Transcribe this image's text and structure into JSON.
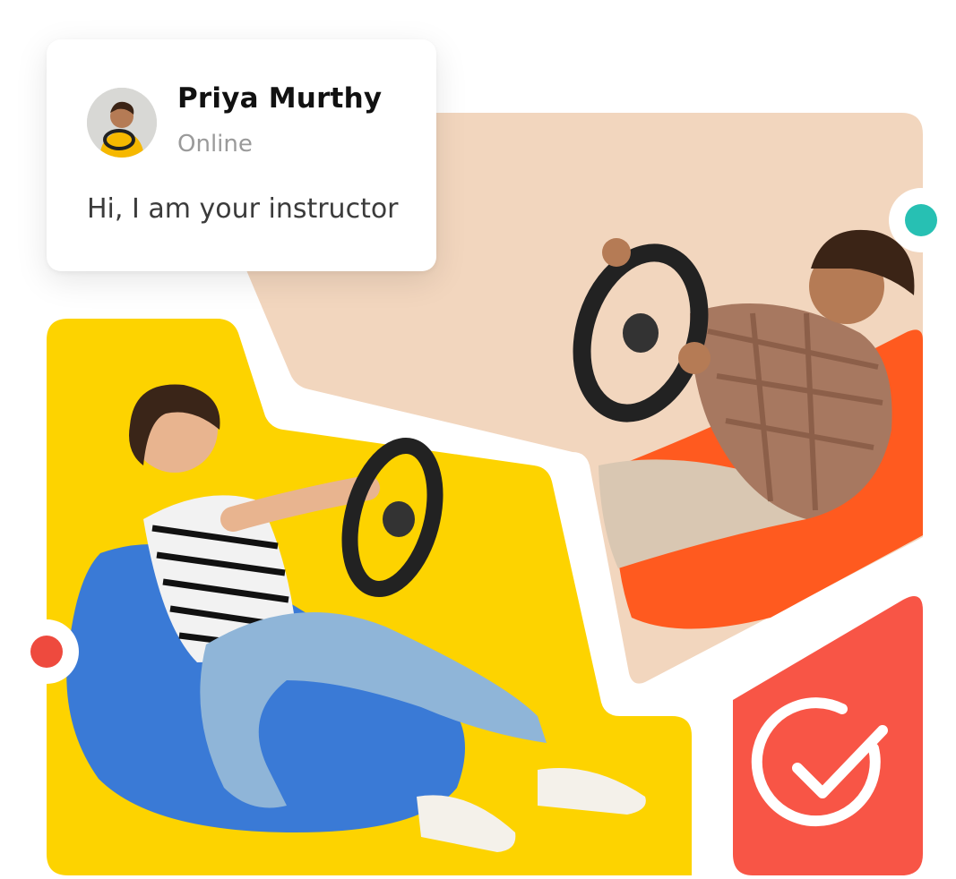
{
  "chat": {
    "name": "Priya Murthy",
    "status": "Online",
    "message": "Hi, I am your instructor",
    "avatar_icon": "avatar-photo-icon"
  },
  "decor": {
    "teal_dot_icon": "teal-dot-icon",
    "red_dot_icon": "red-dot-icon",
    "check_icon": "checkmark-circle-icon"
  },
  "colors": {
    "peach": "#f2d6be",
    "yellow": "#fdd300",
    "coral": "#f85546",
    "teal": "#27c0b3",
    "red_dot": "#ee4a3e",
    "orange_bag": "#ff5a1f",
    "blue_bag": "#3a7ad6"
  }
}
